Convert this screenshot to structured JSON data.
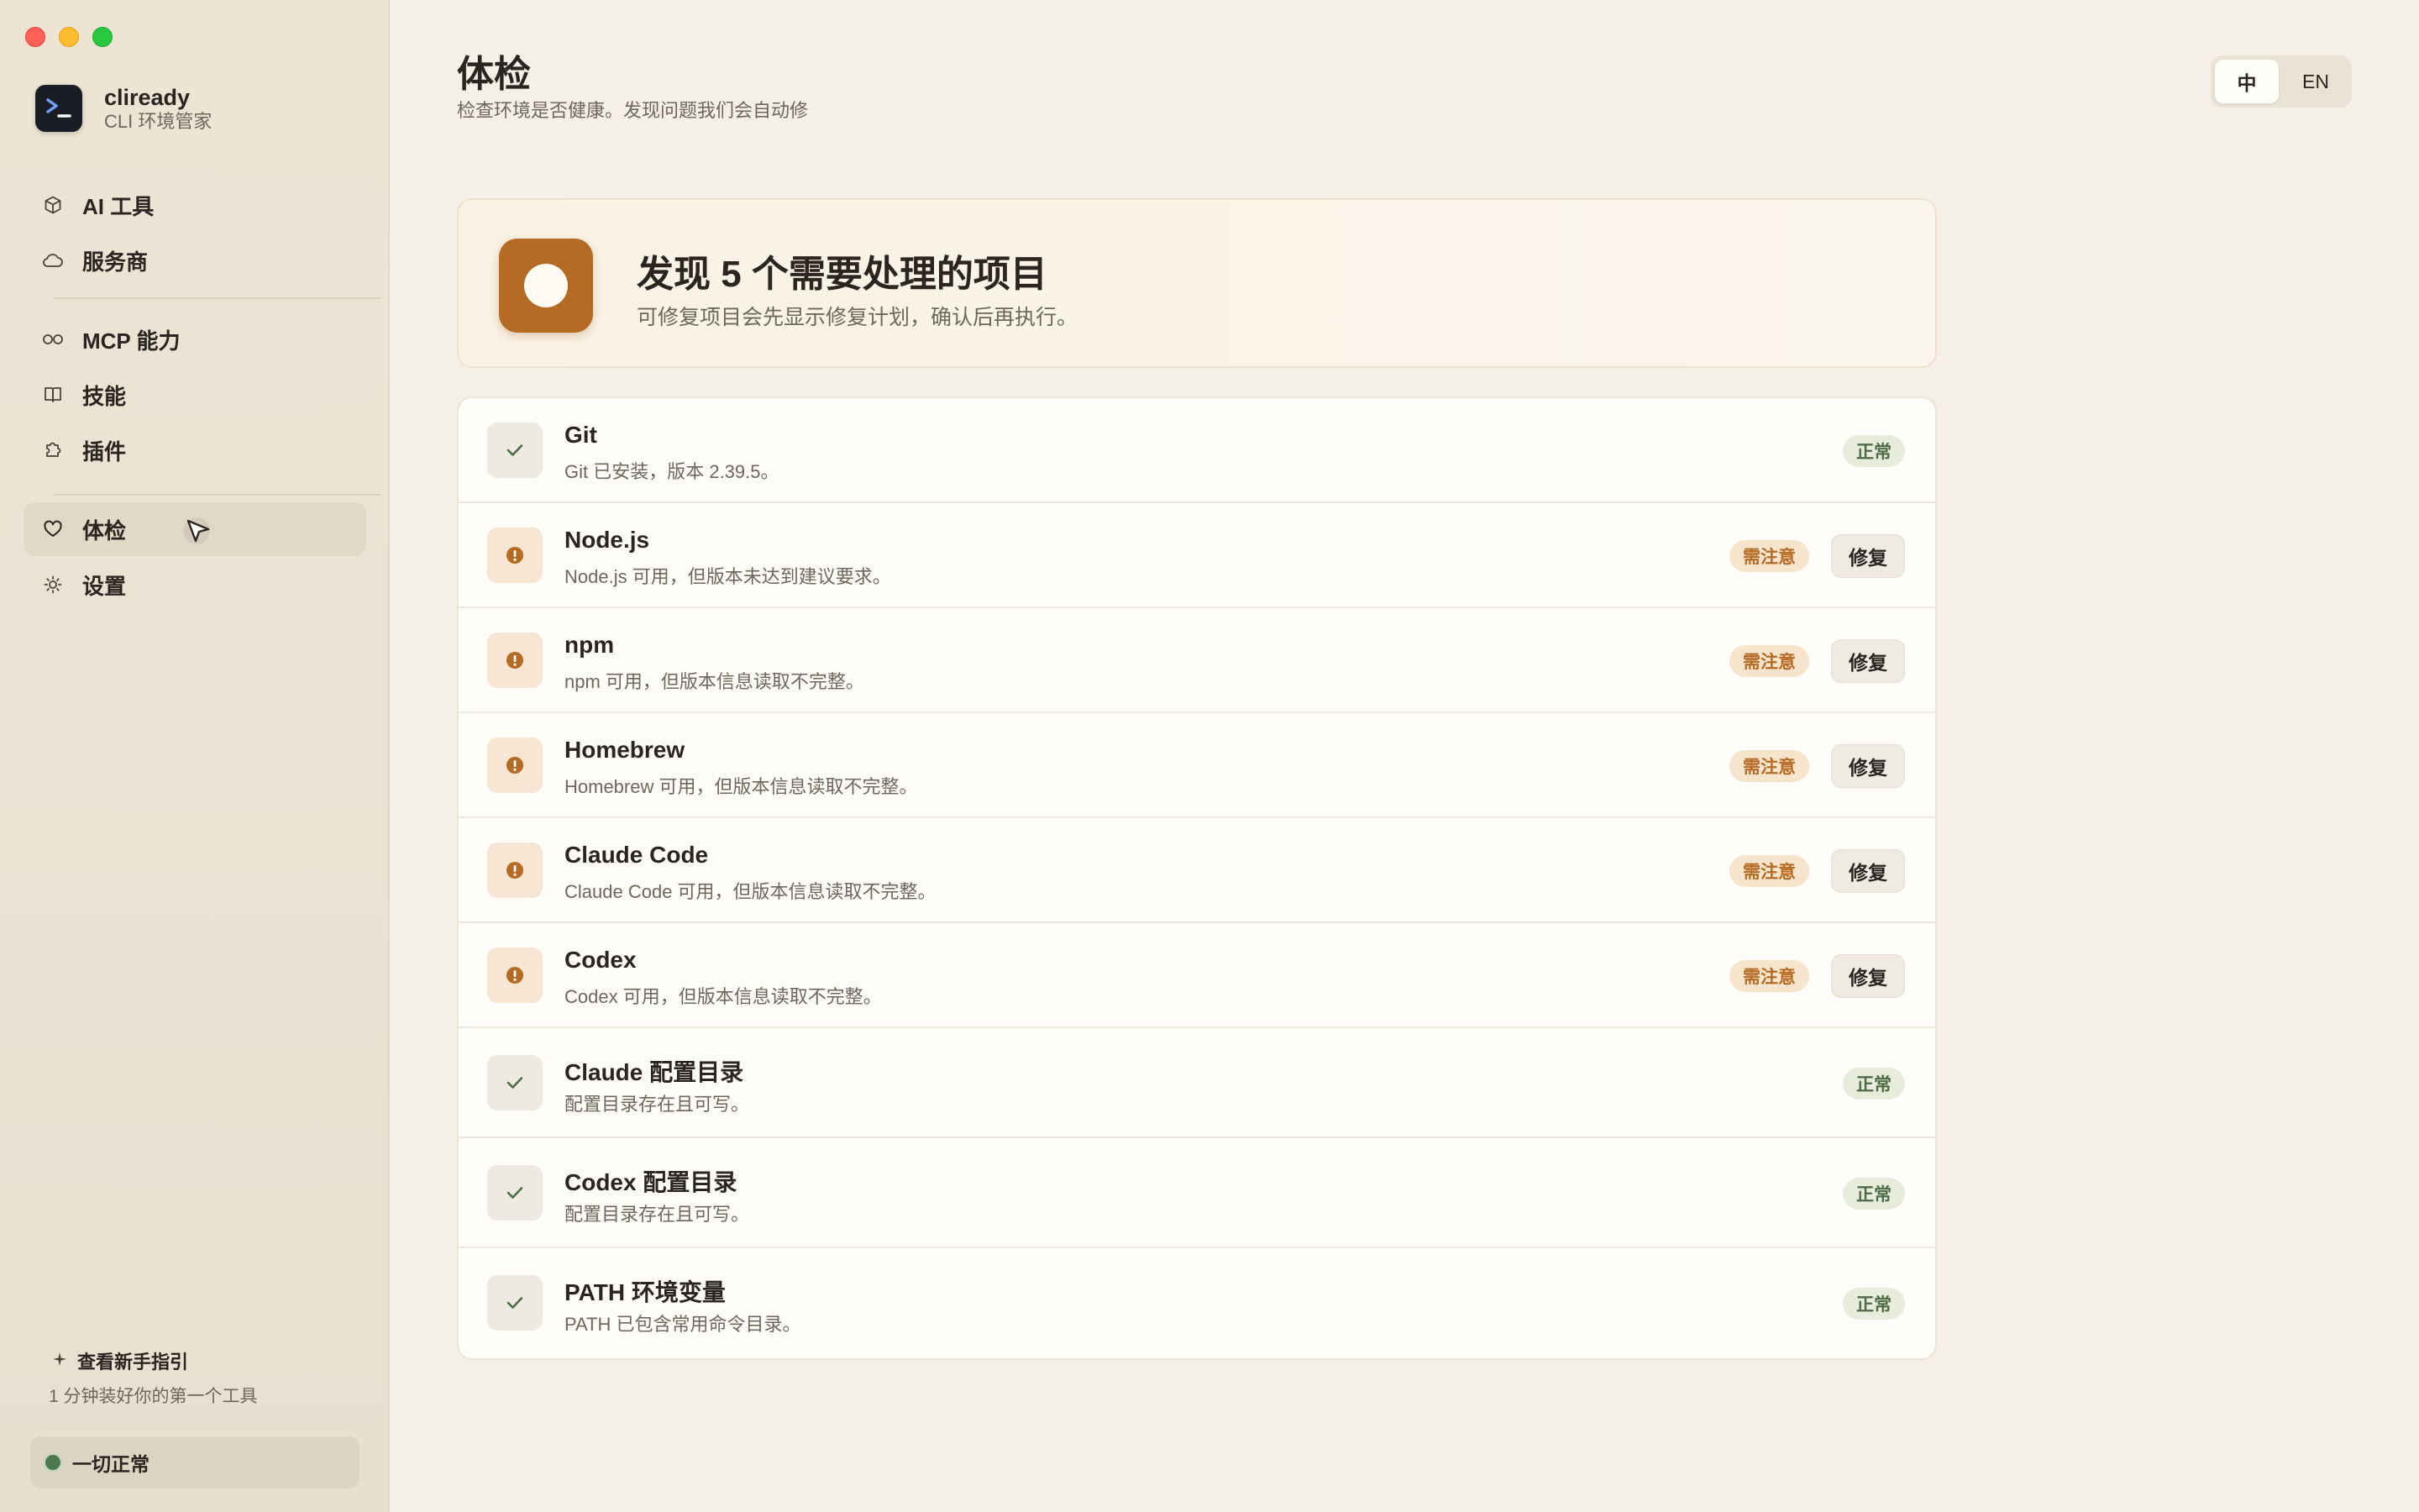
{
  "app": {
    "name": "cliready",
    "subtitle": "CLI 环境管家"
  },
  "sidebar": {
    "items": [
      {
        "label": "AI 工具",
        "icon": "cube-icon"
      },
      {
        "label": "服务商",
        "icon": "cloud-icon"
      },
      {
        "label": "MCP 能力",
        "icon": "infinity-icon"
      },
      {
        "label": "技能",
        "icon": "book-icon"
      },
      {
        "label": "插件",
        "icon": "puzzle-icon"
      },
      {
        "label": "体检",
        "icon": "heart-icon",
        "active": true
      },
      {
        "label": "设置",
        "icon": "sun-icon"
      }
    ],
    "guide_title": "查看新手指引",
    "guide_sub": "1 分钟装好你的第一个工具",
    "status": "一切正常"
  },
  "header": {
    "title": "体检",
    "subtitle": "检查环境是否健康。发现问题我们会自动修"
  },
  "lang": {
    "zh": "中",
    "en": "EN",
    "selected": "中"
  },
  "banner": {
    "title": "发现 5 个需要处理的项目",
    "subtitle": "可修复项目会先显示修复计划，确认后再执行。"
  },
  "checks": [
    {
      "title": "Git",
      "desc": "Git 已安装，版本 2.39.5。",
      "status": "ok",
      "badge": "正常"
    },
    {
      "title": "Node.js",
      "desc": "Node.js 可用，但版本未达到建议要求。",
      "status": "warn",
      "badge": "需注意",
      "action": "修复"
    },
    {
      "title": "npm",
      "desc": "npm 可用，但版本信息读取不完整。",
      "status": "warn",
      "badge": "需注意",
      "action": "修复"
    },
    {
      "title": "Homebrew",
      "desc": "Homebrew 可用，但版本信息读取不完整。",
      "status": "warn",
      "badge": "需注意",
      "action": "修复"
    },
    {
      "title": "Claude Code",
      "desc": "Claude Code 可用，但版本信息读取不完整。",
      "status": "warn",
      "badge": "需注意",
      "action": "修复"
    },
    {
      "title": "Codex",
      "desc": "Codex 可用，但版本信息读取不完整。",
      "status": "warn",
      "badge": "需注意",
      "action": "修复"
    },
    {
      "title": "Claude 配置目录",
      "desc": "配置目录存在且可写。",
      "status": "ok",
      "badge": "正常"
    },
    {
      "title": "Codex 配置目录",
      "desc": "配置目录存在且可写。",
      "status": "ok",
      "badge": "正常"
    },
    {
      "title": "PATH 环境变量",
      "desc": "PATH 已包含常用命令目录。",
      "status": "ok",
      "badge": "正常"
    }
  ],
  "colors": {
    "accent": "#b56b23",
    "ok": "#4d6c44",
    "warn": "#b56b23",
    "status_dot": "#4c7a4e"
  }
}
